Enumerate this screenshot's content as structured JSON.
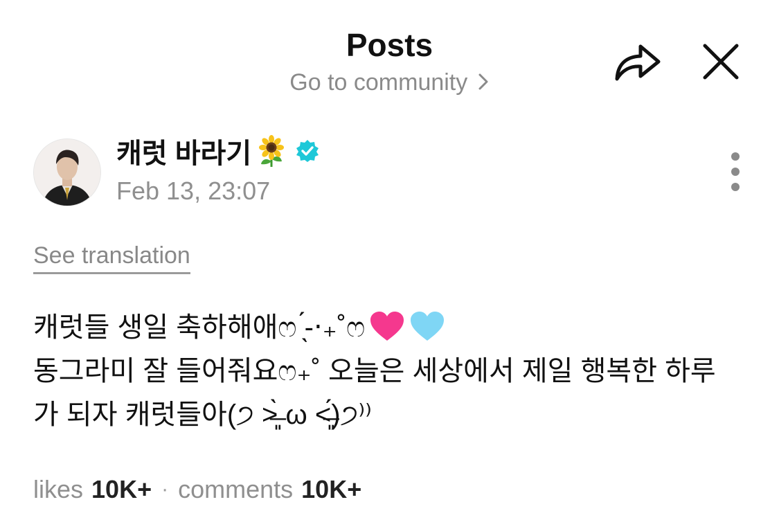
{
  "header": {
    "title": "Posts",
    "community_link": "Go to community",
    "share_icon": "share-arrow-icon",
    "close_icon": "close-icon"
  },
  "post": {
    "author_name": "캐럿 바라기",
    "author_emoji": "sunflower-icon",
    "verified_icon": "verified-badge-icon",
    "timestamp": "Feb 13, 23:07",
    "more_icon": "more-vertical-icon",
    "see_translation": "See translation",
    "content_lines": [
      "캐럿들 생일 축하해애ෆ ̖́-‧₊˚ෆ",
      "동그라미 잘 들어줘요ෆ₊˚ 오늘은 세상에서 제일 행복한 하루",
      "가 되자 캐럿들아(੭ ˃̶͈̀ ω ˂̶͈́)੭⁾⁾"
    ],
    "heart_icons": [
      "pink-heart-icon",
      "light-blue-heart-icon"
    ],
    "colors": {
      "verified": "#1ec8d8",
      "pink_heart": "#f5388e",
      "blue_heart": "#7fd6f5"
    }
  },
  "stats": {
    "likes_label": "likes",
    "likes_value": "10K+",
    "separator": "·",
    "comments_label": "comments",
    "comments_value": "10K+"
  }
}
